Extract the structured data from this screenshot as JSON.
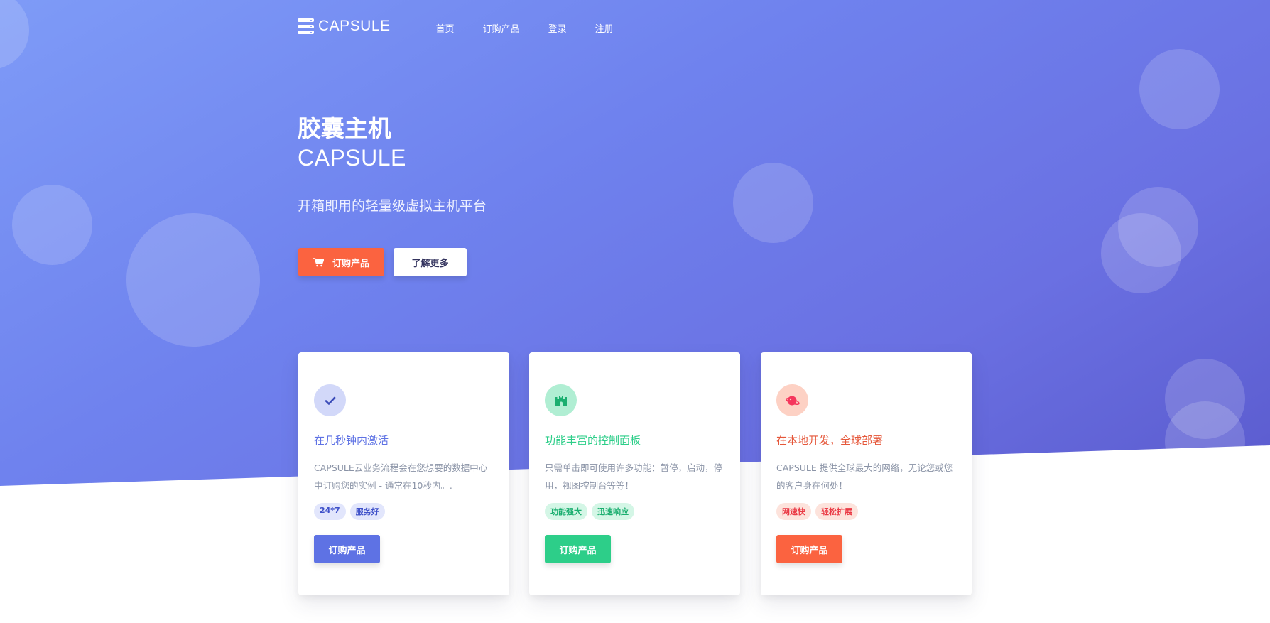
{
  "brand": {
    "name": "CAPSULE"
  },
  "nav": {
    "items": [
      "首页",
      "订购产品",
      "登录",
      "注册"
    ]
  },
  "hero": {
    "title": "胶囊主机",
    "subtitle": "CAPSULE",
    "description": "开箱即用的轻量级虚拟主机平台",
    "primary_button": "订购产品",
    "secondary_button": "了解更多"
  },
  "cards": [
    {
      "icon": "check-icon",
      "title": "在几秒钟内激活",
      "text": "CAPSULE云业务流程会在您想要的数据中心中订购您的实例 - 通常在10秒内。.",
      "badges": [
        "24*7",
        "服务好"
      ],
      "button": "订购产品",
      "color": "#5e72e4"
    },
    {
      "icon": "castle-icon",
      "title": "功能丰富的控制面板",
      "text": "只需单击即可使用许多功能：暂停，启动，停用，视图控制台等等！",
      "badges": [
        "功能强大",
        "迅速响应"
      ],
      "button": "订购产品",
      "color": "#2dce89"
    },
    {
      "icon": "planet-icon",
      "title": "在本地开发，全球部署",
      "text": "CAPSULE 提供全球最大的网络，无论您或您的客户身在何处！",
      "badges": [
        "网速快",
        "轻松扩展"
      ],
      "button": "订购产品",
      "color": "#fb6340"
    }
  ]
}
